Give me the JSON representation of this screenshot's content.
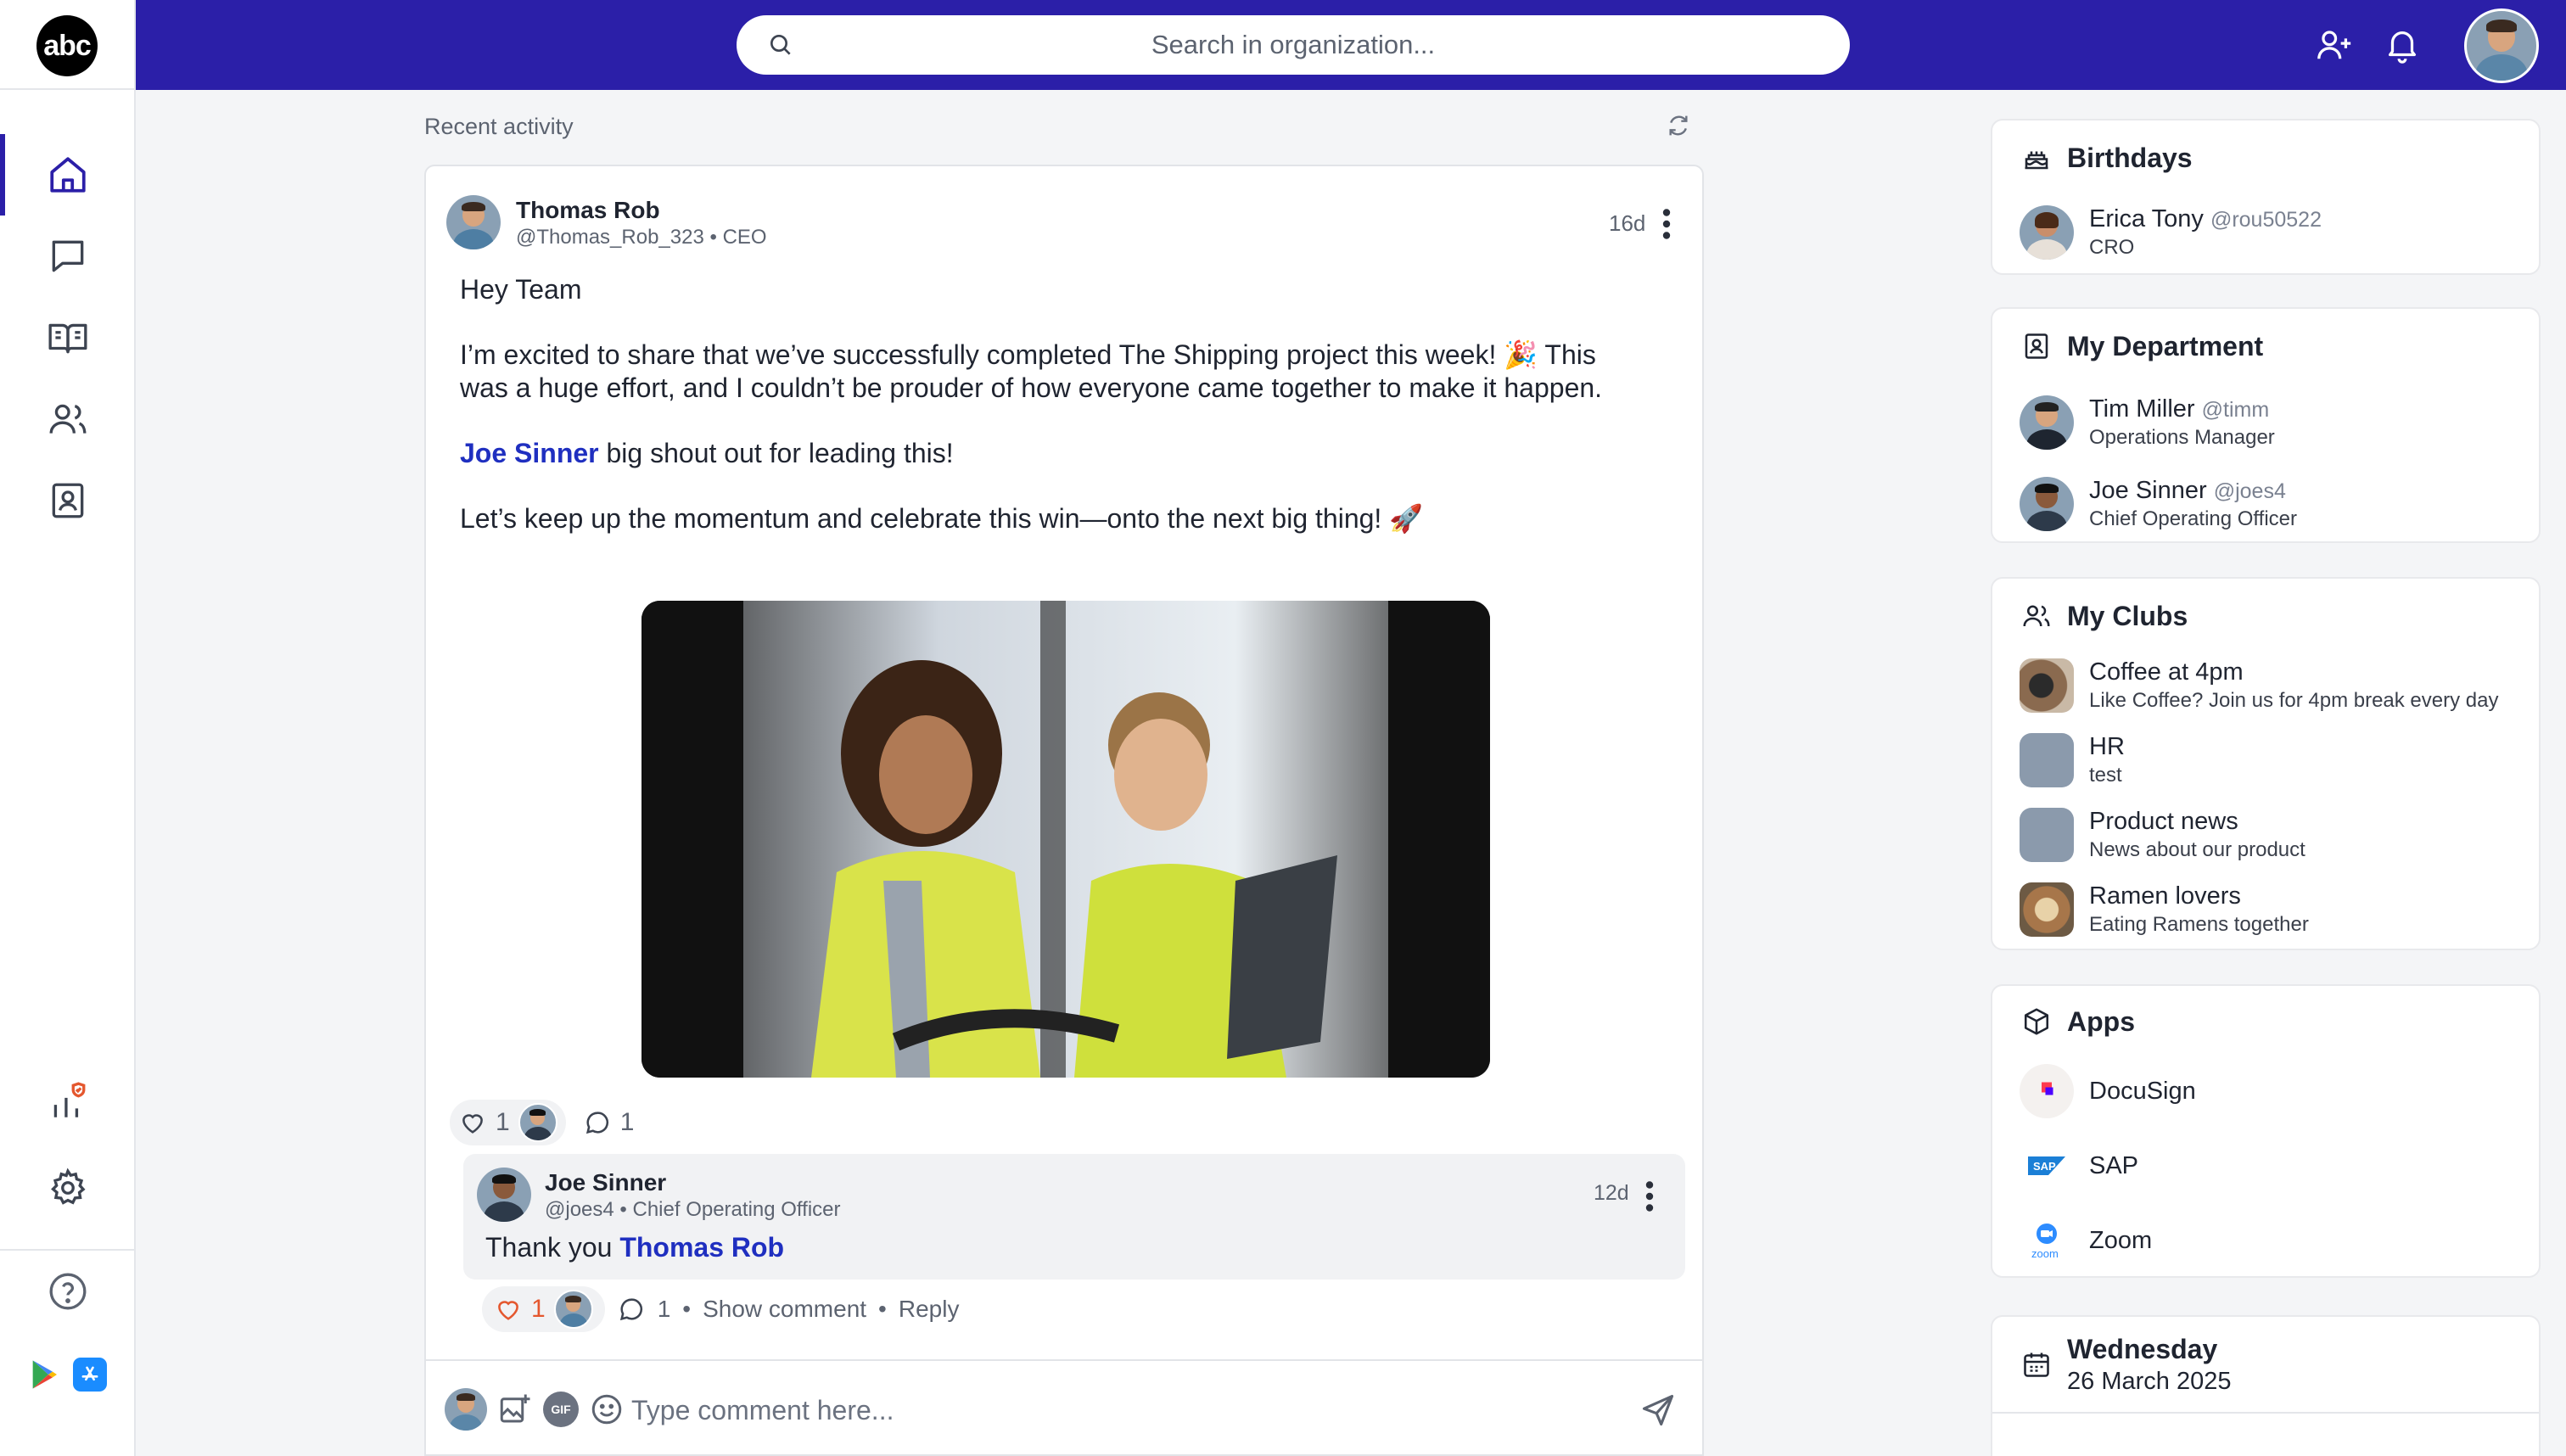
{
  "brand": {
    "logo_text": "abc",
    "accent": "#2b1fa8"
  },
  "search": {
    "placeholder": "Search in organization..."
  },
  "feed": {
    "title": "Recent activity",
    "post": {
      "author": "Thomas Rob",
      "handle": "@Thomas_Rob_323",
      "role": "CEO",
      "time": "16d",
      "greeting": "Hey Team",
      "paragraph1": "I’m excited to share that we’ve successfully completed The Shipping project this week! 🎉 This was a huge effort, and I couldn’t be prouder of how everyone came together to make it happen.",
      "mention": "Joe Sinner",
      "shoutout": " big shout out for leading this!",
      "closing": "Let’s keep up the momentum and celebrate this win—onto the next big thing! 🚀",
      "likes": "1",
      "comments": "1"
    },
    "comment": {
      "author": "Joe Sinner",
      "handle": "@joes4",
      "role": "Chief Operating Officer",
      "time": "12d",
      "text": "Thank you ",
      "mention": "Thomas Rob",
      "likes": "1",
      "replies": "1",
      "show_comment": "Show comment",
      "reply": "Reply"
    },
    "composer": {
      "placeholder": "Type comment here...",
      "gif_label": "GIF"
    }
  },
  "birthdays": {
    "title": "Birthdays",
    "people": [
      {
        "name": "Erica Tony",
        "handle": "@rou50522",
        "role": "CRO"
      }
    ]
  },
  "department": {
    "title": "My Department",
    "people": [
      {
        "name": "Tim Miller",
        "handle": "@timm",
        "role": "Operations Manager"
      },
      {
        "name": "Joe Sinner",
        "handle": "@joes4",
        "role": "Chief Operating Officer"
      }
    ]
  },
  "clubs": {
    "title": "My Clubs",
    "items": [
      {
        "name": "Coffee at 4pm",
        "desc": "Like Coffee? Join us for 4pm break every day"
      },
      {
        "name": "HR",
        "desc": "test"
      },
      {
        "name": "Product news",
        "desc": "News about our product"
      },
      {
        "name": "Ramen lovers",
        "desc": "Eating Ramens together"
      }
    ]
  },
  "apps": {
    "title": "Apps",
    "items": [
      {
        "name": "DocuSign"
      },
      {
        "name": "SAP"
      },
      {
        "name": "Zoom"
      }
    ]
  },
  "calendar": {
    "weekday": "Wednesday",
    "date": "26 March 2025"
  }
}
